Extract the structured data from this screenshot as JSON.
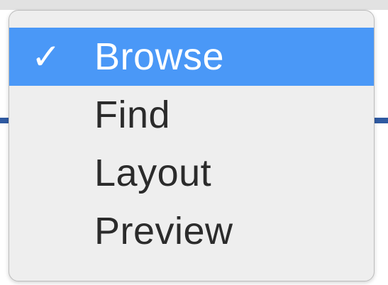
{
  "menu": {
    "items": [
      {
        "label": "Browse",
        "checked": true,
        "check_glyph": "✓"
      },
      {
        "label": "Find",
        "checked": false,
        "check_glyph": ""
      },
      {
        "label": "Layout",
        "checked": false,
        "check_glyph": ""
      },
      {
        "label": "Preview",
        "checked": false,
        "check_glyph": ""
      }
    ],
    "selected_index": 0
  },
  "colors": {
    "selection": "#4a98f7",
    "menu_bg": "#eeeeee",
    "text": "#2b2b2b",
    "rule": "#2f5aa1"
  }
}
